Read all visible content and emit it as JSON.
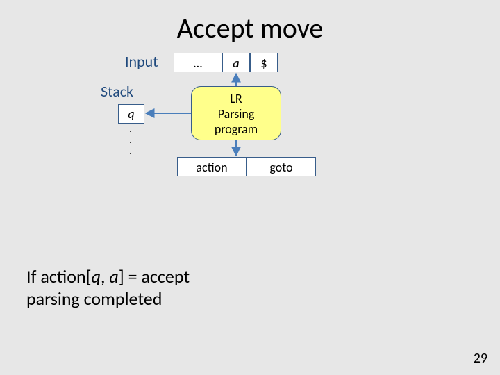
{
  "title": "Accept move",
  "labels": {
    "input": "Input",
    "stack": "Stack"
  },
  "input_tape": {
    "dots": "…",
    "a": "a",
    "end": "$"
  },
  "stack": {
    "top": "q",
    "dots": "."
  },
  "parser": {
    "line1": "LR",
    "line2": "Parsing",
    "line3": "program"
  },
  "tables": {
    "action": "action",
    "goto": "goto"
  },
  "caption": {
    "prefix": "If action[",
    "q": "q",
    "comma": ", ",
    "a": "a",
    "suffix": "] = accept",
    "line2": "parsing completed"
  },
  "page": "29"
}
